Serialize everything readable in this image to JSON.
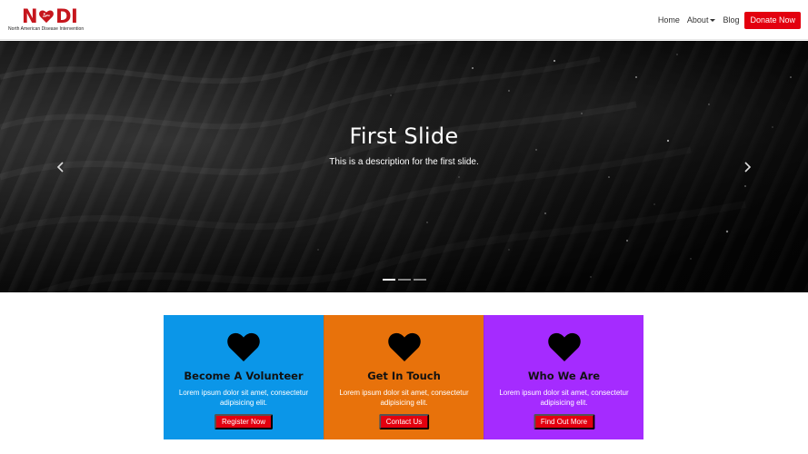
{
  "brand": {
    "letters_left": "N",
    "letters_right": "DI",
    "tagline": "North American Disease Intervention",
    "color": "#c6161d"
  },
  "nav": {
    "items": [
      {
        "label": "Home"
      },
      {
        "label": "About",
        "has_dropdown": true
      },
      {
        "label": "Blog"
      }
    ],
    "cta_label": "Donate Now",
    "cta_color": "#e3000f"
  },
  "hero": {
    "slide_title": "First Slide",
    "slide_description": "This is a description for the first slide.",
    "prev_icon": "chevron-left-icon",
    "next_icon": "chevron-right-icon",
    "slide_count": 3,
    "active_slide": 1
  },
  "cards": [
    {
      "title": "Become A Volunteer",
      "text": "Lorem ipsum dolor sit amet, consectetur adipisicing elit.",
      "button": "Register Now",
      "color": "#0b96e8",
      "icon": "heart-icon"
    },
    {
      "title": "Get In Touch",
      "text": "Lorem ipsum dolor sit amet, consectetur adipisicing elit.",
      "button": "Contact Us",
      "color": "#e8720b",
      "icon": "heart-icon"
    },
    {
      "title": "Who We Are",
      "text": "Lorem ipsum dolor sit amet, consectetur adipisicing elit.",
      "button": "Find Out More",
      "color": "#a52bff",
      "icon": "heart-icon"
    }
  ]
}
